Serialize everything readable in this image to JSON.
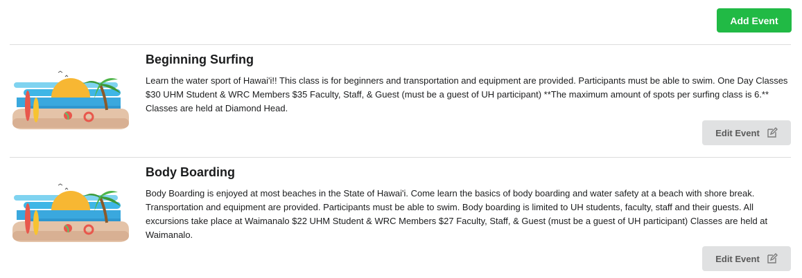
{
  "toolbar": {
    "add_event_label": "Add Event"
  },
  "events": [
    {
      "title": "Beginning Surfing",
      "description": "Learn the water sport of Hawai'i!! This class is for beginners and transportation and equipment are provided. Participants must be able to swim. One Day Classes $30 UHM Student & WRC Members $35 Faculty, Staff, & Guest (must be a guest of UH participant) **The maximum amount of spots per surfing class is 6.** Classes are held at Diamond Head.",
      "edit_label": "Edit Event",
      "image": "beach-illustration"
    },
    {
      "title": "Body Boarding",
      "description": "Body Boarding is enjoyed at most beaches in the State of Hawai'i. Come learn the basics of body boarding and water safety at a beach with shore break. Transportation and equipment are provided. Participants must be able to swim. Body boarding is limited to UH students, faculty, staff and their guests. All excursions take place at Waimanalo $22 UHM Student & WRC Members $27 Faculty, Staff, & Guest (must be a guest of UH participant) Classes are held at Waimanalo.",
      "edit_label": "Edit Event",
      "image": "beach-illustration"
    }
  ],
  "icons": {
    "edit": "edit-icon"
  },
  "colors": {
    "add_button": "#21ba45",
    "edit_button": "#e0e1e2",
    "divider": "#dcdcdc"
  }
}
